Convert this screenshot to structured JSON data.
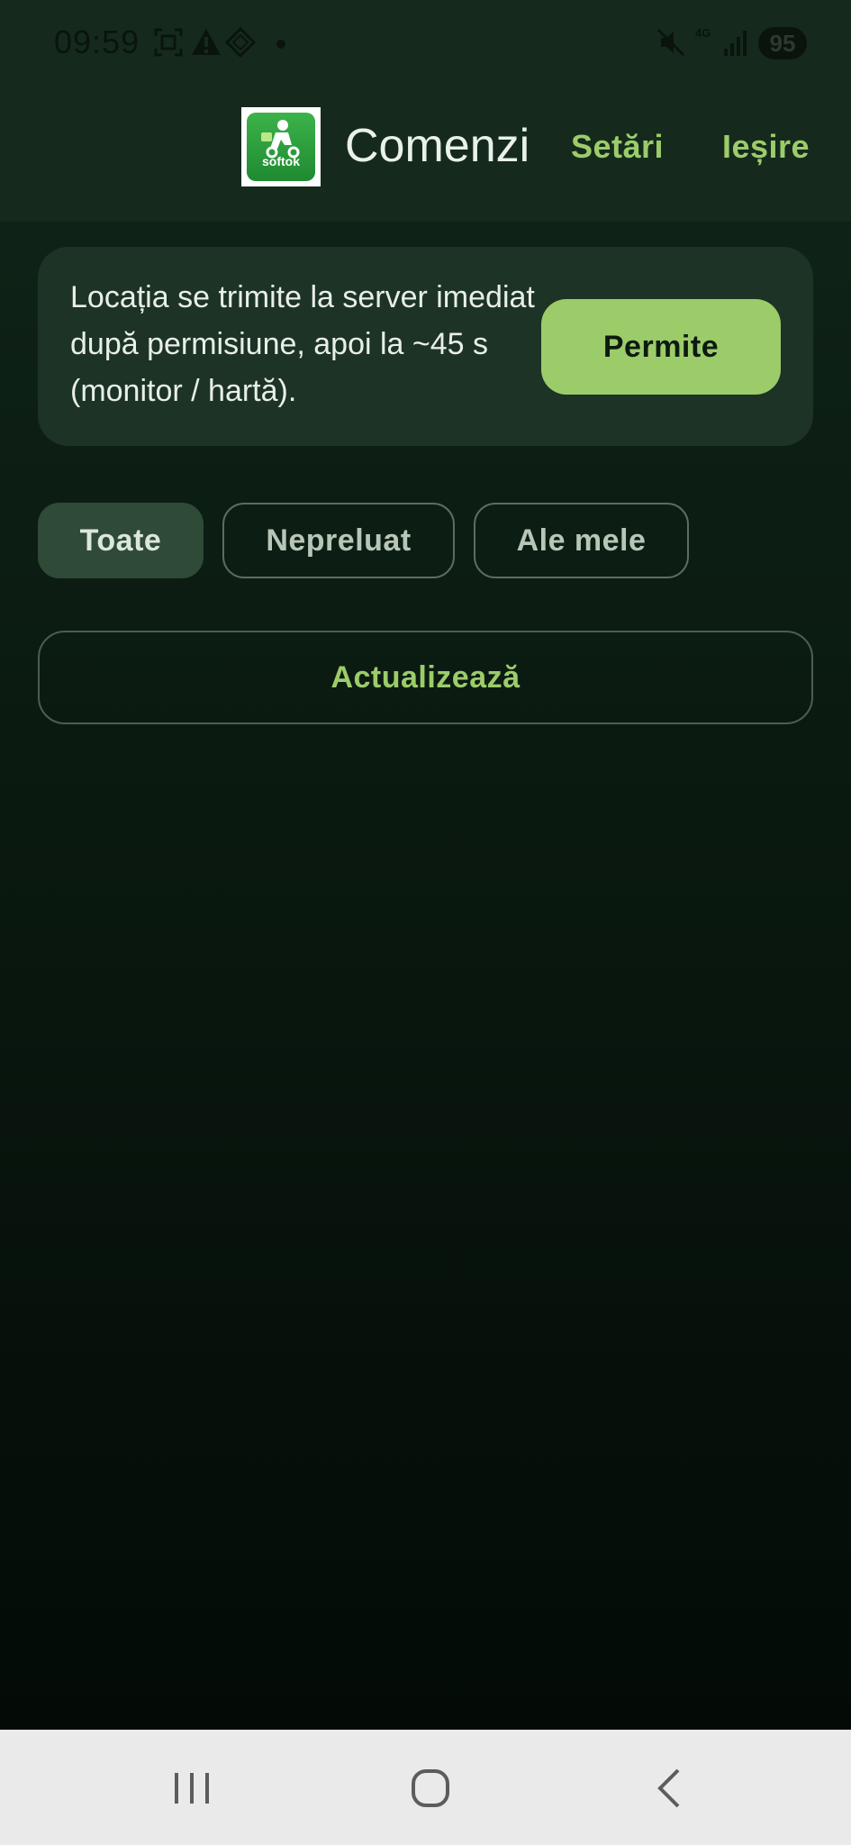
{
  "status_bar": {
    "time": "09:59",
    "network": "4G",
    "battery": "95",
    "icons": [
      "screenshot-icon",
      "warning-icon",
      "vpn-icon",
      "dot-icon",
      "mute-icon",
      "signal-icon"
    ]
  },
  "header": {
    "logo_text": "softok",
    "title": "Comenzi",
    "settings_label": "Setări",
    "logout_label": "Ieșire"
  },
  "location_banner": {
    "message": "Locația se trimite la server imediat după permisiune, apoi la ~45 s (monitor / hartă).",
    "allow_label": "Permite"
  },
  "filters": {
    "items": [
      {
        "label": "Toate",
        "active": true
      },
      {
        "label": "Nepreluat",
        "active": false
      },
      {
        "label": "Ale mele",
        "active": false
      }
    ]
  },
  "refresh_label": "Actualizează",
  "colors": {
    "accent": "#9ccc6a",
    "background": "#0c1d13",
    "header": "#152a1d",
    "banner": "#1d3325",
    "chip_active": "#2f4a36"
  },
  "nav_bar": {
    "icons": [
      "recent-apps-icon",
      "home-icon",
      "back-icon"
    ]
  }
}
